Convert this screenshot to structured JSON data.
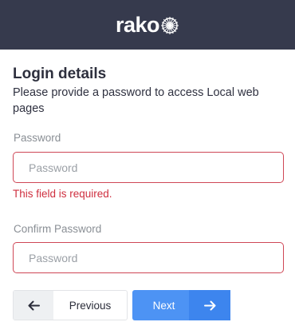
{
  "header": {
    "logo_text": "rako",
    "background_color": "#363a4d"
  },
  "form": {
    "title": "Login details",
    "subtitle": "Please provide a password to access Local web pages",
    "password": {
      "label": "Password",
      "placeholder": "Password",
      "value": "",
      "error": "This field is required."
    },
    "confirm_password": {
      "label": "Confirm Password",
      "placeholder": "Password",
      "value": ""
    }
  },
  "buttons": {
    "previous": {
      "label": "Previous",
      "icon": "arrow-left-icon"
    },
    "next": {
      "label": "Next",
      "icon": "arrow-right-icon",
      "color": "#4d93f4"
    }
  },
  "colors": {
    "error": "#cf2f3f",
    "input_border_error": "#cf4756"
  }
}
